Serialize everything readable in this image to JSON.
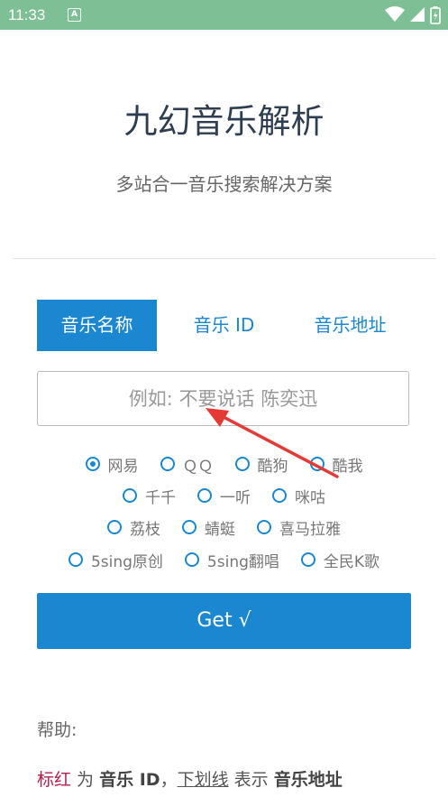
{
  "status_bar": {
    "time": "11:33",
    "notification_icon": "A",
    "icons": [
      "wifi-icon",
      "signal-icon",
      "battery-icon"
    ]
  },
  "header": {
    "title": "九幻音乐解析",
    "subtitle": "多站合一音乐搜索解决方案"
  },
  "tabs": [
    {
      "label": "音乐名称",
      "active": true
    },
    {
      "label": "音乐 ID",
      "active": false
    },
    {
      "label": "音乐地址",
      "active": false
    }
  ],
  "search": {
    "value": "",
    "placeholder": "例如: 不要说话 陈奕迅"
  },
  "sources": {
    "selected": "网易",
    "rows": [
      [
        "网易",
        "ＱＱ",
        "酷狗",
        "酷我"
      ],
      [
        "千千",
        "一听",
        "咪咕"
      ],
      [
        "荔枝",
        "蜻蜓",
        "喜马拉雅"
      ],
      [
        "5sing原创",
        "5sing翻唱",
        "全民K歌"
      ]
    ]
  },
  "get_button": {
    "label": "Get √"
  },
  "help": {
    "label": "帮助:",
    "red_text": "标红",
    "t1": " 为 ",
    "bold1": "音乐 ID",
    "t2": "，",
    "underline_text": "下划线",
    "t3": " 表示 ",
    "bold2": "音乐地址"
  },
  "colors": {
    "accent": "#1a87d0",
    "status_bar": "#7fbf95",
    "help_red": "#b3224a",
    "annotation_arrow": "#e53935"
  }
}
